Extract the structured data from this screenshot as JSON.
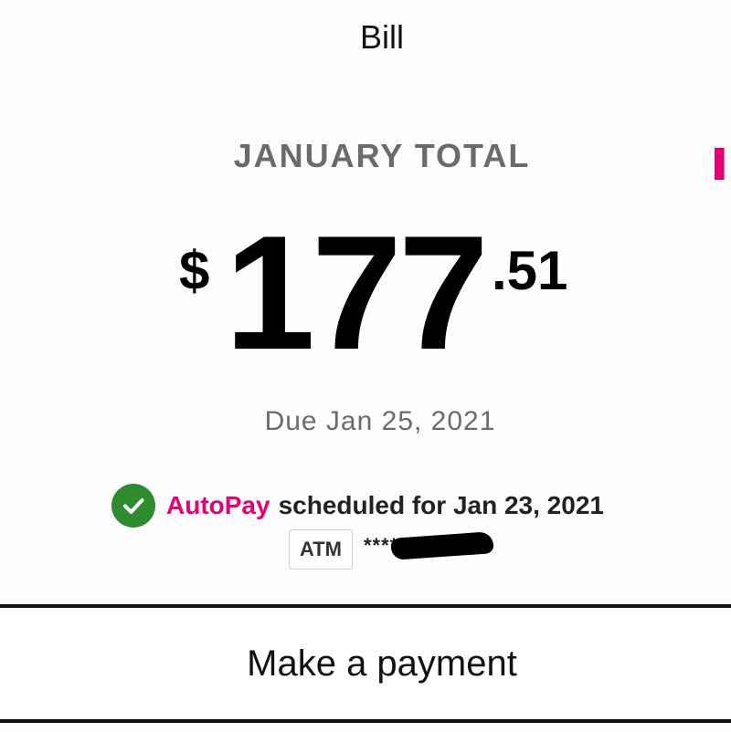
{
  "header": {
    "title": "Bill"
  },
  "bill": {
    "period_label": "JANUARY TOTAL",
    "amount": {
      "currency_symbol": "$",
      "whole": "177",
      "cents": ".51"
    },
    "due_text": "Due Jan 25, 2021"
  },
  "autopay": {
    "name": "AutoPay",
    "status_text": "scheduled for Jan 23, 2021",
    "payment_method": {
      "badge": "ATM",
      "masked_number": "****"
    }
  },
  "actions": {
    "make_payment_label": "Make a payment"
  },
  "colors": {
    "brand": "#e20074",
    "success": "#2e8b2e",
    "muted_text": "#6b6b6b"
  },
  "icons": {
    "autopay_status": "check-circle-icon",
    "side_edge": "partial-brand-icon"
  }
}
